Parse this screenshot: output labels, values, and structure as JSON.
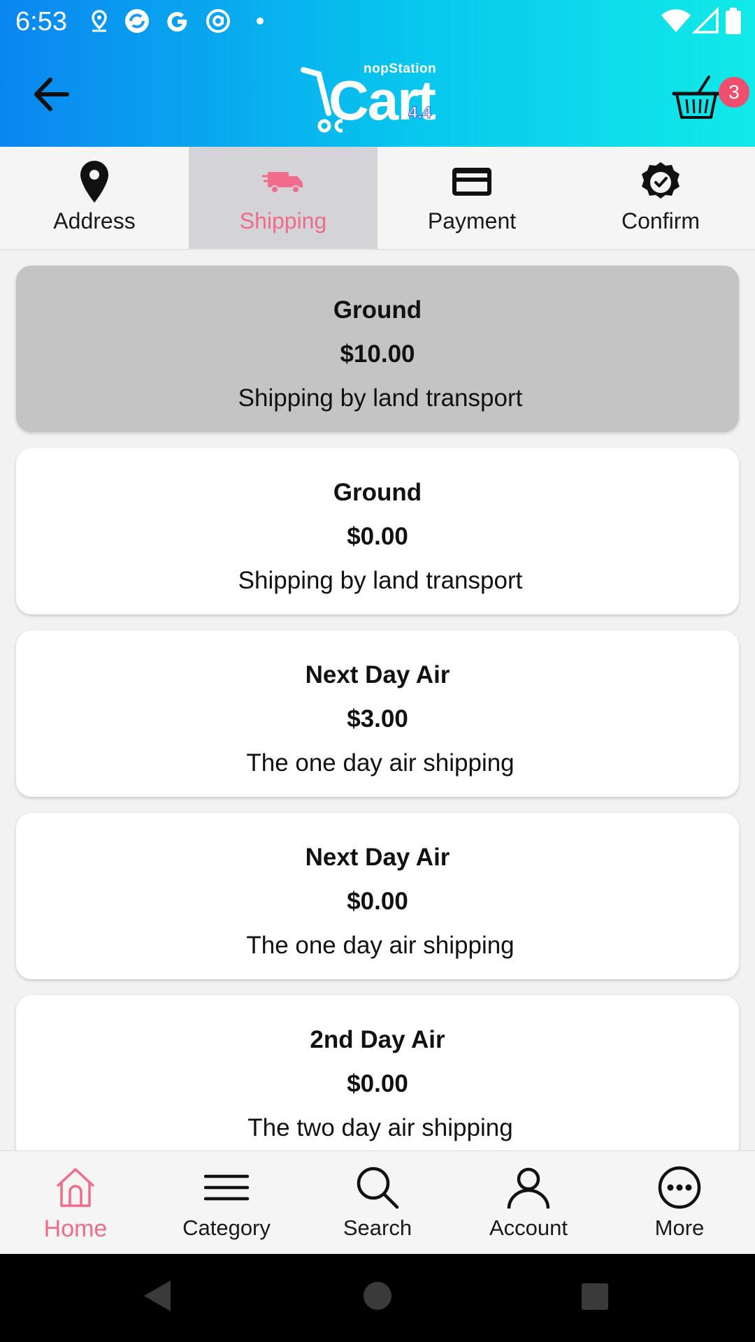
{
  "status_bar": {
    "time": "6:53"
  },
  "header": {
    "logo_brand": "nopStation",
    "logo_word": "Cart",
    "logo_version": "4.4",
    "cart_count": "3"
  },
  "steps": [
    {
      "label": "Address",
      "icon": "location-pin-icon"
    },
    {
      "label": "Shipping",
      "icon": "truck-icon"
    },
    {
      "label": "Payment",
      "icon": "credit-card-icon"
    },
    {
      "label": "Confirm",
      "icon": "badge-check-icon"
    }
  ],
  "shipping_options": [
    {
      "name": "Ground",
      "price": "$10.00",
      "description": "Shipping by land transport",
      "selected": true
    },
    {
      "name": "Ground",
      "price": "$0.00",
      "description": "Shipping by land transport",
      "selected": false
    },
    {
      "name": "Next Day Air",
      "price": "$3.00",
      "description": "The one day air shipping",
      "selected": false
    },
    {
      "name": "Next Day Air",
      "price": "$0.00",
      "description": "The one day air shipping",
      "selected": false
    },
    {
      "name": "2nd Day Air",
      "price": "$0.00",
      "description": "The two day air shipping",
      "selected": false
    }
  ],
  "bottom_nav": [
    {
      "label": "Home",
      "icon": "home-icon"
    },
    {
      "label": "Category",
      "icon": "menu-lines-icon"
    },
    {
      "label": "Search",
      "icon": "search-icon"
    },
    {
      "label": "Account",
      "icon": "user-icon"
    },
    {
      "label": "More",
      "icon": "more-dots-icon"
    }
  ],
  "colors": {
    "accent": "#f06c8a",
    "header_gradient_start": "#0a86f0",
    "header_gradient_end": "#11eae8",
    "selected_card": "#c4c4c4",
    "active_step_bg": "#d3d3d8"
  }
}
